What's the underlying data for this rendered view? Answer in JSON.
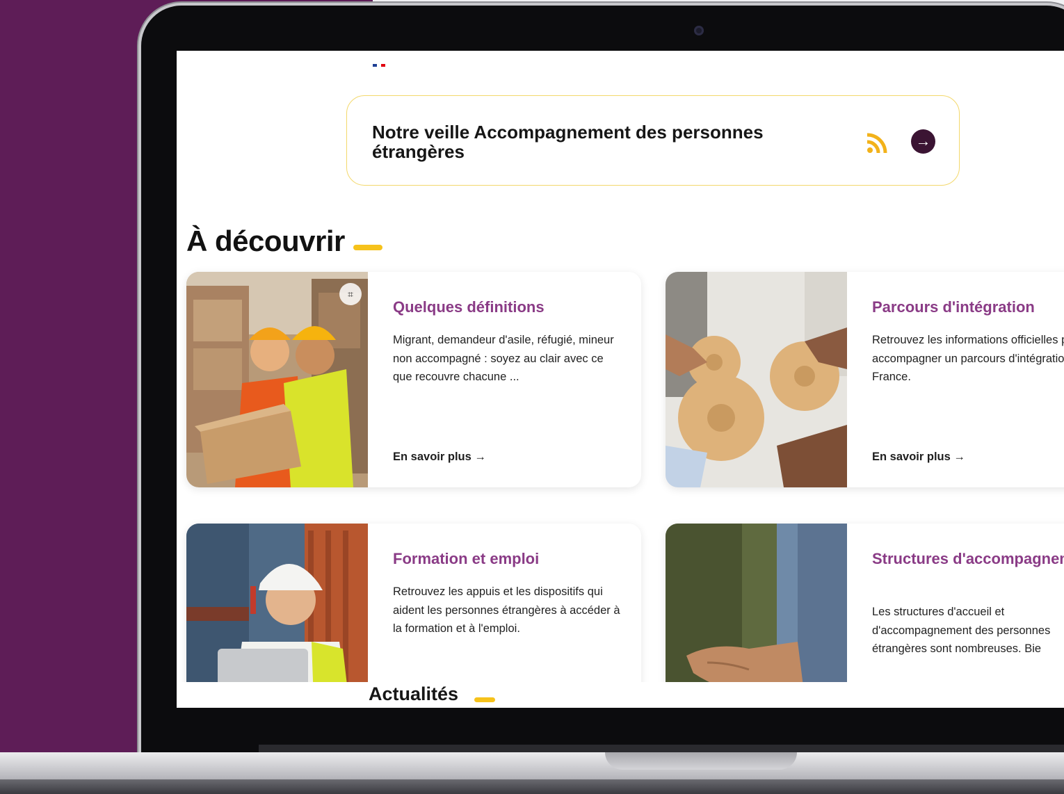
{
  "veille": {
    "title": "Notre veille Accompagnement des personnes étrangères",
    "rss_icon": "rss-icon",
    "arrow_icon": "arrow-right-circle-icon"
  },
  "decouvrir": {
    "heading": "À découvrir"
  },
  "cards": [
    {
      "title": "Quelques définitions",
      "text": "Migrant, demandeur d'asile, réfugié, mineur non accompagné : soyez au clair avec ce que recouvre chacune ...",
      "link": "En savoir plus →"
    },
    {
      "title": "Parcours d'intégration",
      "text": "Retrouvez les informations officielles pour accompagner un parcours d'intégration en France.",
      "link": "En savoir plus →"
    },
    {
      "title": "Formation et emploi",
      "text": "Retrouvez les appuis et les dispositifs qui aident les personnes étrangères à accéder à la formation et à l'emploi."
    },
    {
      "title": "Structures d'accompagnement",
      "text": "Les structures d'accueil et d'accompagnement des personnes étrangères sont nombreuses. Bie"
    }
  ],
  "actualites": {
    "heading": "Actualités"
  },
  "colors": {
    "background": "#5e1d57",
    "accent": "#f6c21b",
    "card_title": "#8a3b86",
    "button": "#3b1433"
  }
}
